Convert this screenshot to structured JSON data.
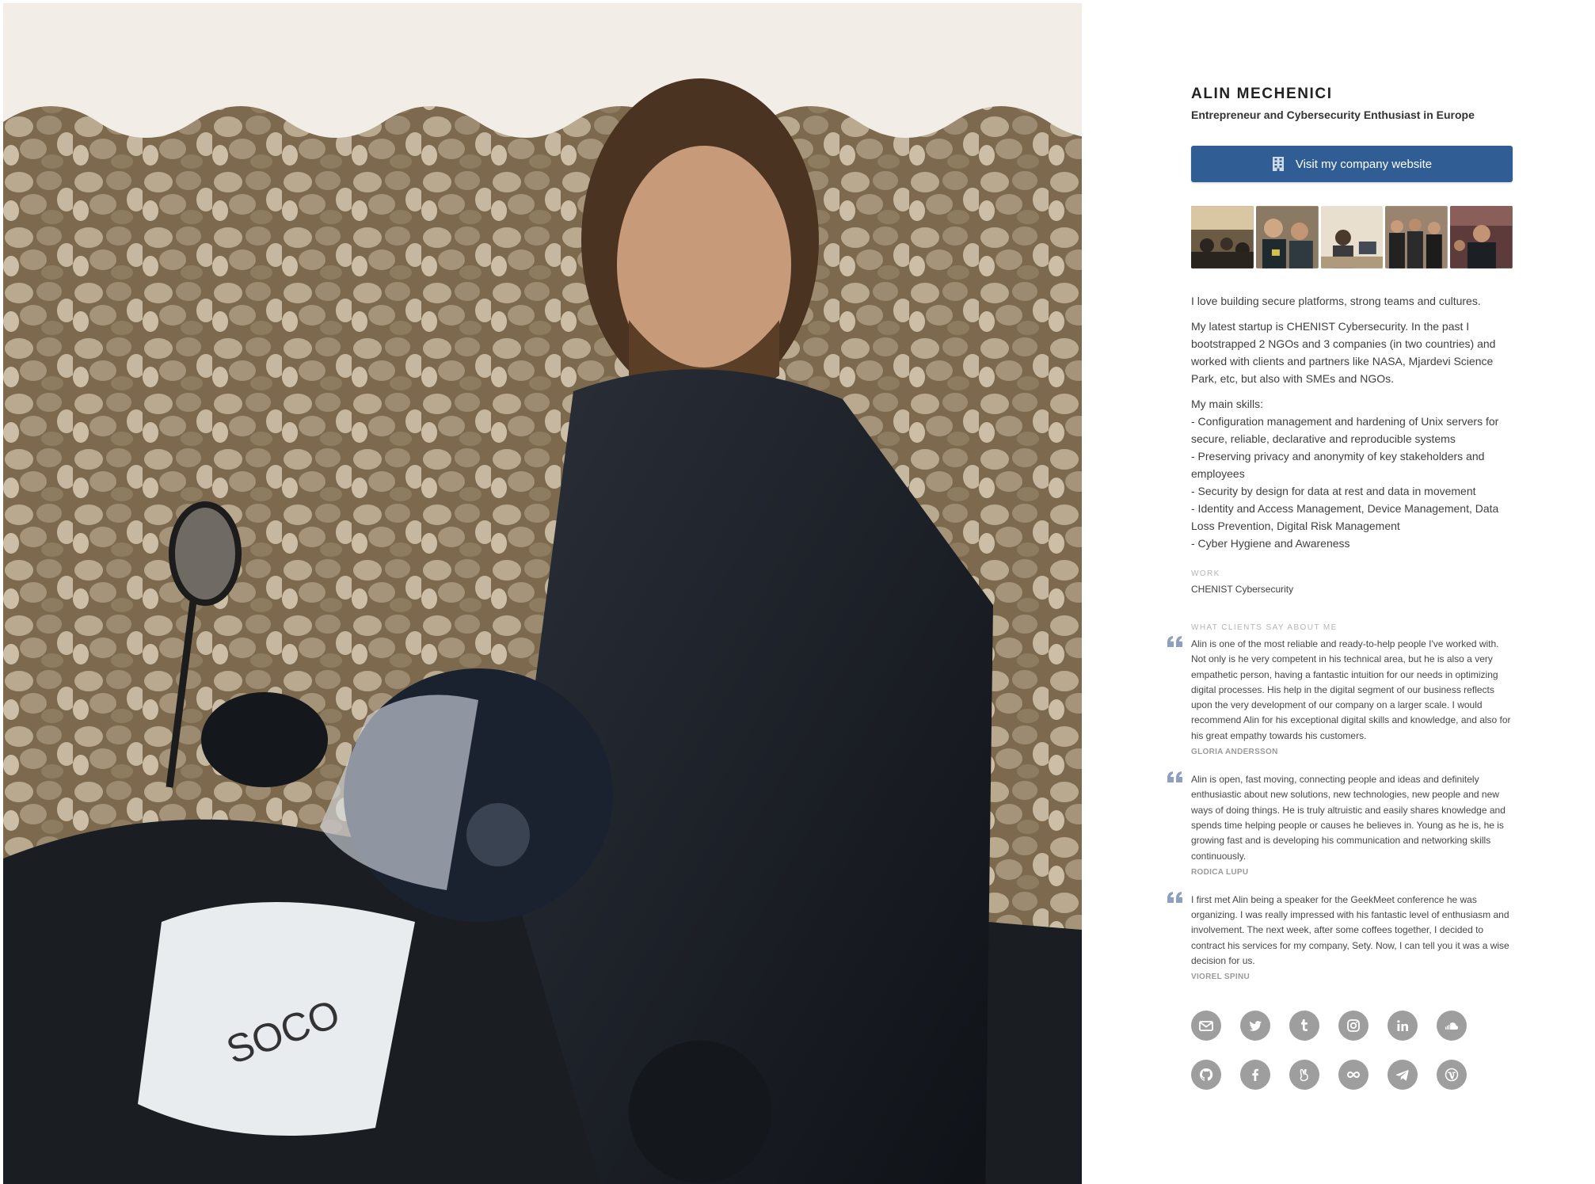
{
  "profile": {
    "name": "ALIN MECHENICI",
    "tagline": "Entrepreneur and Cybersecurity Enthusiast in Europe"
  },
  "website_button": {
    "label": "Visit my company website",
    "icon": "building-icon"
  },
  "gallery": {
    "photos": [
      "gallery-photo-1",
      "gallery-photo-2",
      "gallery-photo-3",
      "gallery-photo-4",
      "gallery-photo-5"
    ]
  },
  "bio": {
    "intro": "I love building secure platforms, strong teams and cultures.",
    "startup": "My latest startup is CHENIST Cybersecurity. In the past I bootstrapped 2 NGOs and 3 companies (in two countries) and worked with clients and partners like NASA, Mjardevi Science Park, etc, but also with SMEs and NGOs.",
    "skills_heading": "My main skills:",
    "skills": [
      "- Configuration management and hardening of Unix servers for secure, reliable, declarative and reproducible systems",
      "- Preserving privacy and anonymity of key stakeholders and employees",
      "- Security by design for data at rest and data in movement",
      "- Identity and Access Management, Device Management, Data Loss Prevention, Digital Risk Management",
      "- Cyber Hygiene and Awareness"
    ]
  },
  "work": {
    "label": "WORK",
    "value": "CHENIST Cybersecurity"
  },
  "testimonials": {
    "label": "WHAT CLIENTS SAY ABOUT ME",
    "items": [
      {
        "text": "Alin is one of the most reliable and ready-to-help people I've worked with. Not only is he very competent in his technical area, but he is also a very empathetic person, having a fantastic intuition for our needs in optimizing digital processes. His help in the digital segment of our business reflects upon the very development of our company on a larger scale. I would recommend Alin for his exceptional digital skills and knowledge, and also for his great empathy towards his customers.",
        "author": "GLORIA ANDERSSON"
      },
      {
        "text": "Alin is open, fast moving, connecting people and ideas and definitely enthusiastic about new solutions, new technologies, new people and new ways of doing things. He is truly altruistic and easily shares knowledge and spends time helping people or causes he believes in. Young as he is, he is growing fast and is developing his communication and networking skills continuously.",
        "author": "RODICA LUPU"
      },
      {
        "text": "I first met Alin being a speaker for the GeekMeet conference he was organizing. I was really impressed with his fantastic level of enthusiasm and involvement. The next week, after some coffees together, I decided to contract his services for my company, Sety. Now, I can tell you it was a wise decision for us.",
        "author": "VIOREL SPINU"
      }
    ]
  },
  "socials": [
    {
      "icon": "email-icon"
    },
    {
      "icon": "twitter-icon"
    },
    {
      "icon": "tumblr-icon"
    },
    {
      "icon": "instagram-icon"
    },
    {
      "icon": "linkedin-icon"
    },
    {
      "icon": "soundcloud-icon"
    },
    {
      "icon": "github-icon"
    },
    {
      "icon": "facebook-icon"
    },
    {
      "icon": "angellist-icon"
    },
    {
      "icon": "infinity-icon"
    },
    {
      "icon": "telegram-icon"
    },
    {
      "icon": "wordpress-icon"
    }
  ],
  "colors": {
    "button": "#2f5d94",
    "social_icon": "#9e9e9e",
    "quote_icon": "#8e9fbf",
    "label": "#b5b5b5"
  }
}
